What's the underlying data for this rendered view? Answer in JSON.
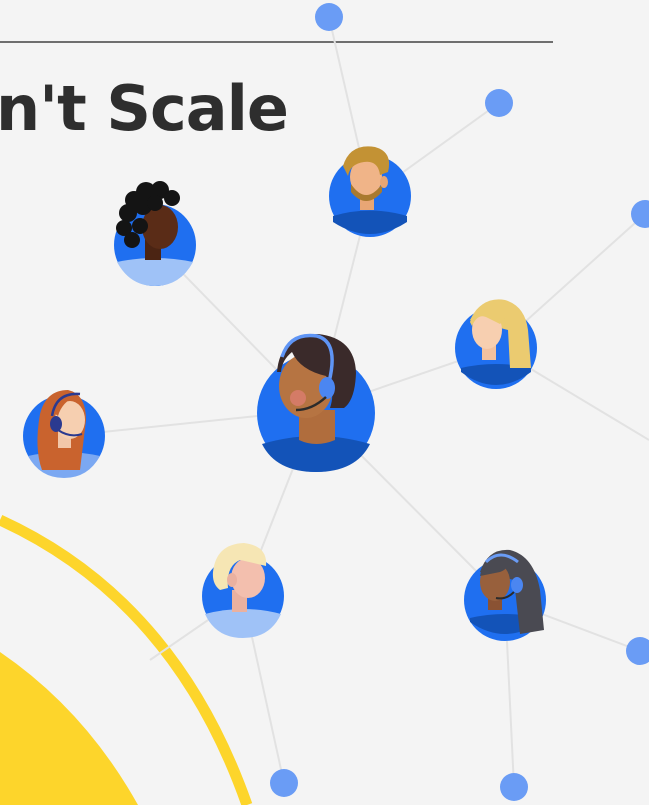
{
  "heading": {
    "title": "n't Scale"
  },
  "colors": {
    "background": "#f4f4f4",
    "connector": "#e2e2e2",
    "node": "#6a9cf5",
    "avatar_ring": "#1f6ff0",
    "accent_yellow": "#fdd52b"
  },
  "avatars": [
    {
      "name": "agent-center-headset",
      "headset": true
    },
    {
      "name": "person-bearded-blond",
      "headset": false
    },
    {
      "name": "person-curly-black-hair",
      "headset": false
    },
    {
      "name": "person-blonde-long-hair",
      "headset": false
    },
    {
      "name": "agent-red-curly-hair-headset",
      "headset": true
    },
    {
      "name": "person-platinum-hair",
      "headset": false
    },
    {
      "name": "agent-long-dark-hair-headset",
      "headset": true
    }
  ]
}
